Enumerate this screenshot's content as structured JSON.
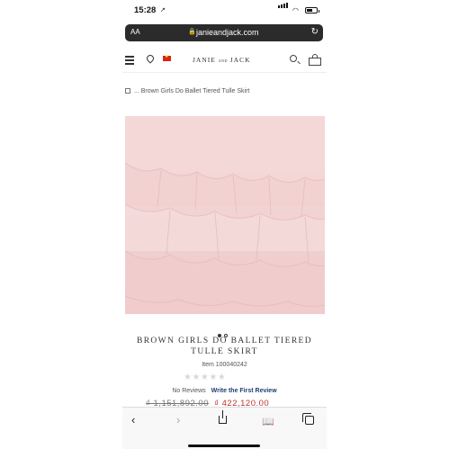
{
  "status_bar": {
    "time": "15:28",
    "location_arrow": "↗"
  },
  "browser": {
    "text_size_label": "AA",
    "url": "janieandjack.com",
    "lock_icon": "lock-icon",
    "reload_icon": "reload-icon"
  },
  "site_header": {
    "brand_main": "JANIE",
    "brand_and": "AND",
    "brand_end": "JACK",
    "flag_star": "★",
    "menu_icon": "hamburger-menu-icon",
    "location_icon": "map-pin-icon",
    "search_icon": "search-icon",
    "bag_icon": "shopping-bag-icon"
  },
  "breadcrumb": {
    "ellipsis": "...",
    "current": "Brown Girls Do Ballet Tiered Tulle Skirt"
  },
  "gallery": {
    "dot_count": 2,
    "active_index": 0
  },
  "product": {
    "title": "BROWN GIRLS DO BALLET TIERED TULLE SKIRT",
    "item_number": "Item 100040242",
    "rating_stars": "★★★★★",
    "reviews_text": "No Reviews",
    "write_review": "Write the First Review",
    "price_original": "₫ 1,151,892.00",
    "price_sale": "₫ 422,120.00"
  },
  "toolbar": {
    "back": "‹",
    "forward": "›",
    "bookmarks": "📖"
  },
  "colors": {
    "sale_price": "#c0332b",
    "link": "#1f3f6e",
    "skirt_pink": "#f3d3d3",
    "url_bar": "#2b2b2b"
  }
}
